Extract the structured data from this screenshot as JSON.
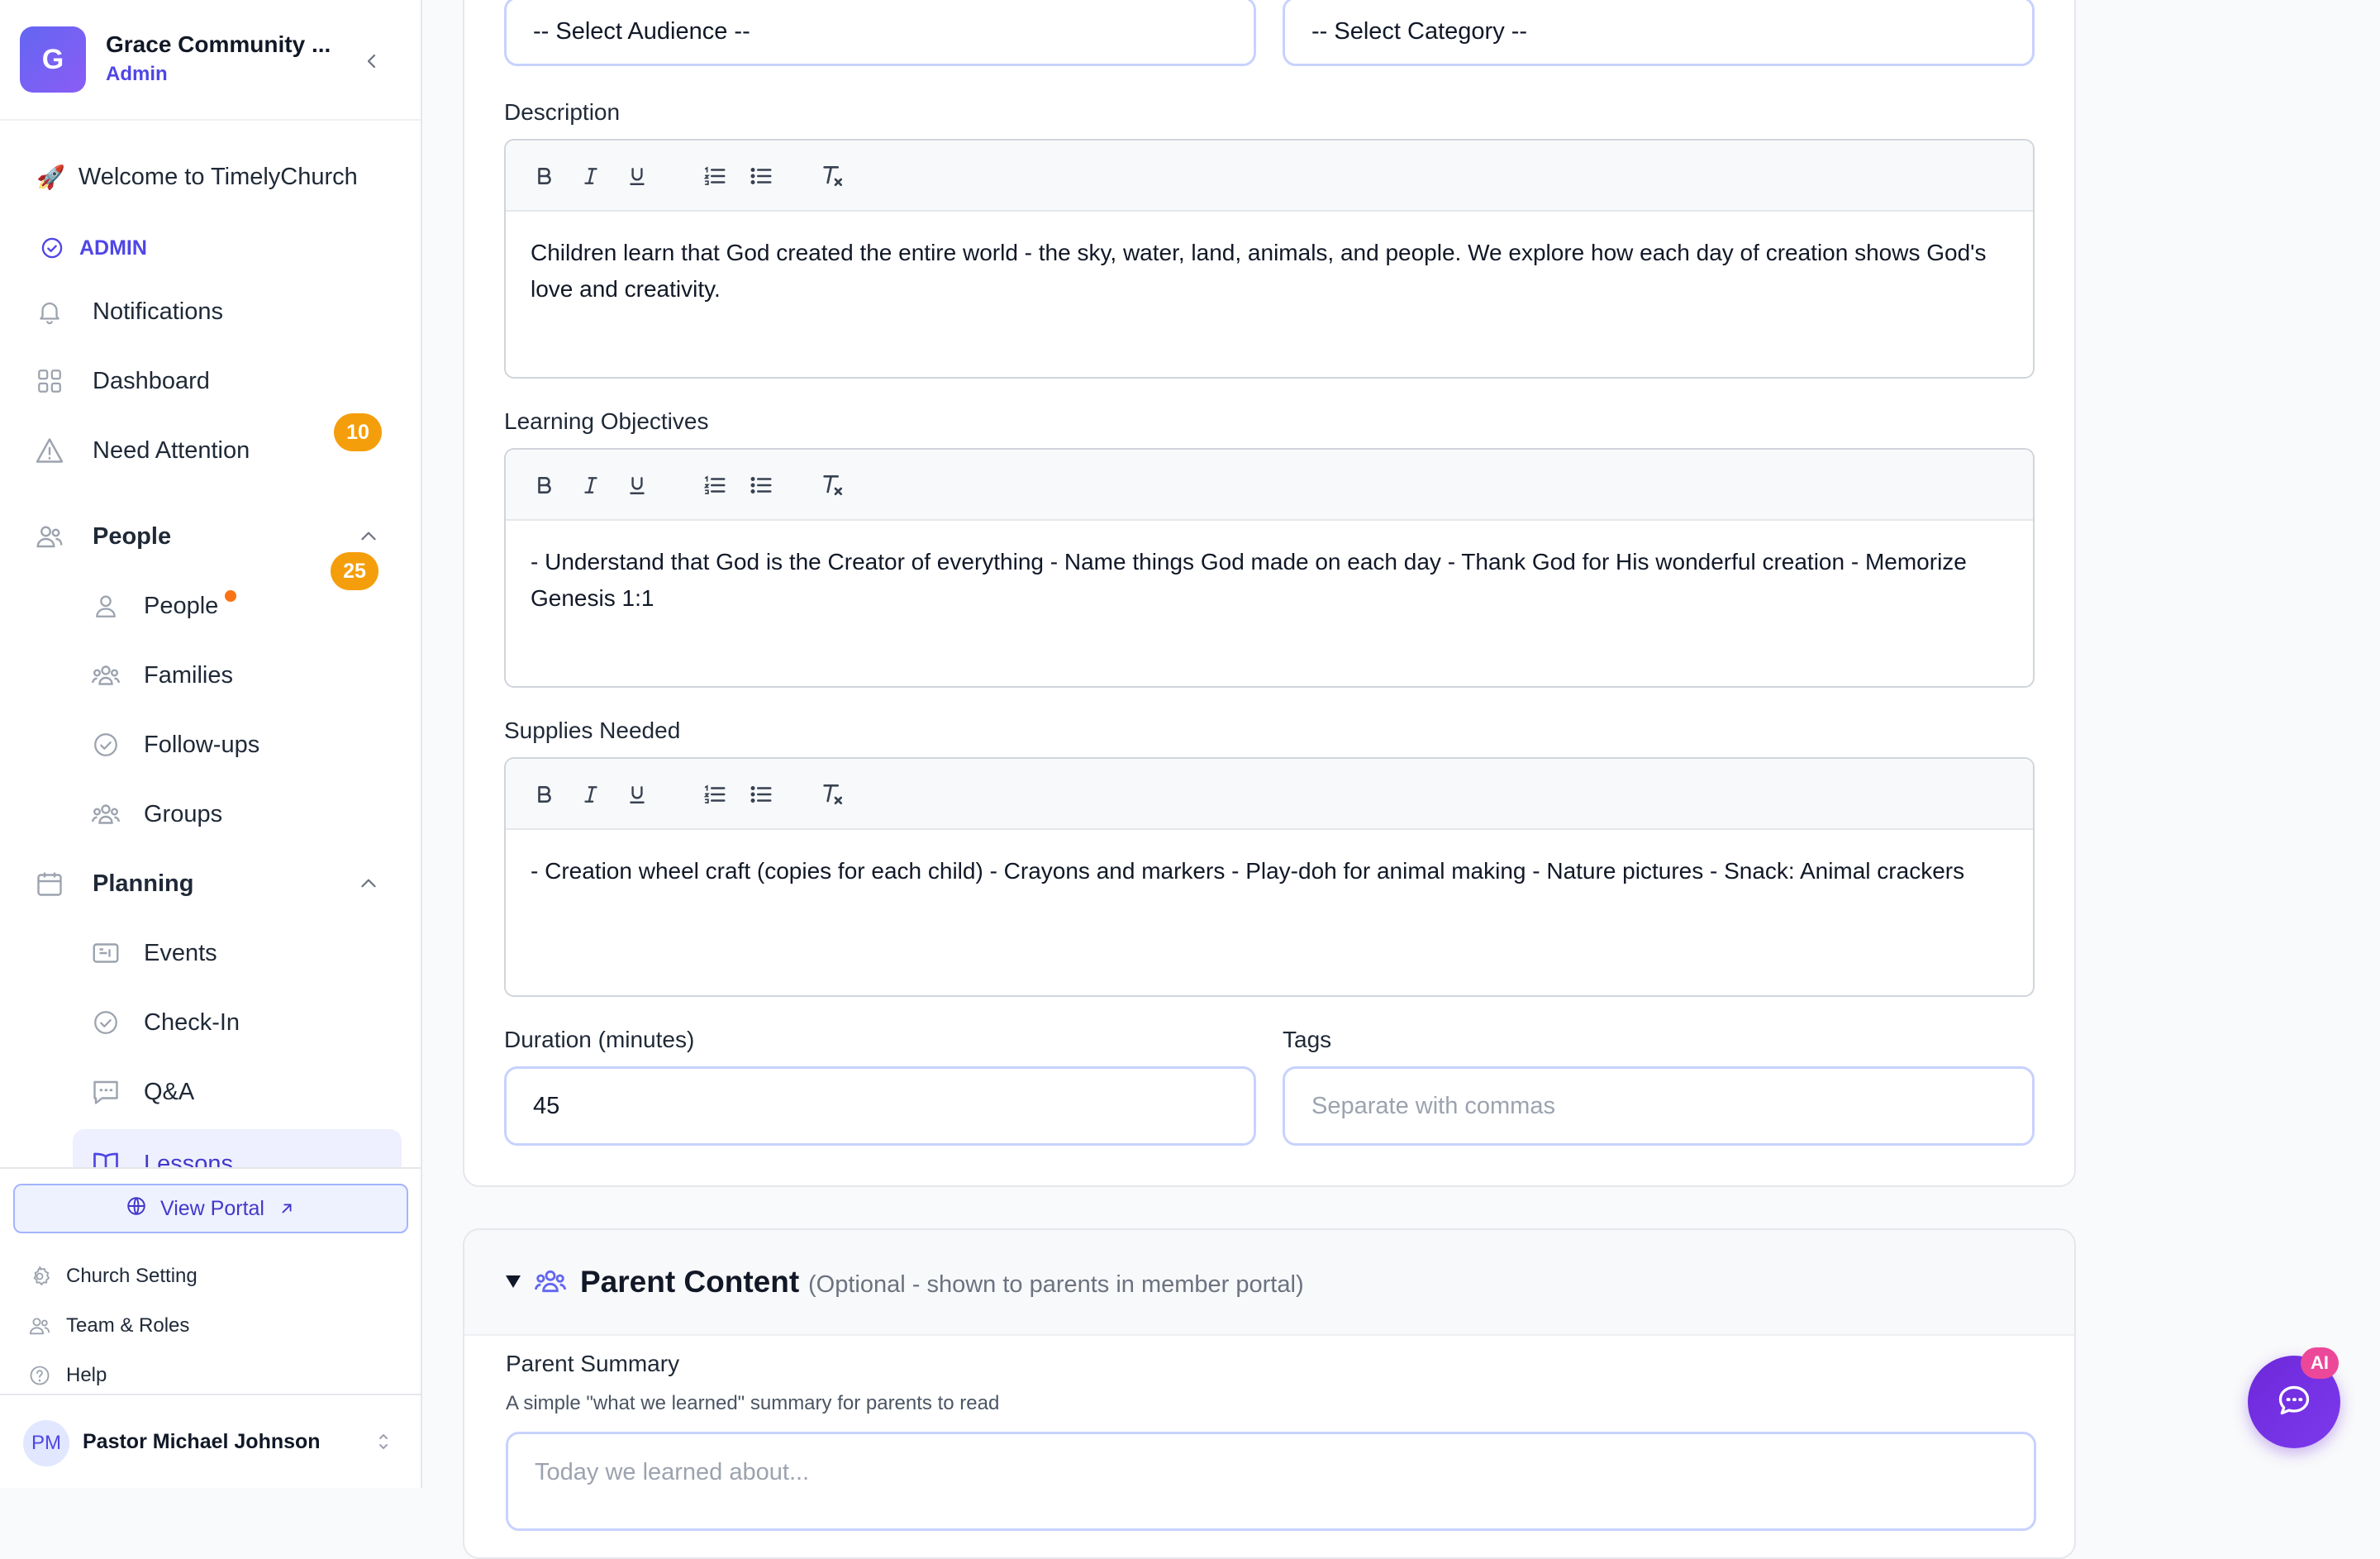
{
  "org": {
    "initial": "G",
    "name": "Grace Community ...",
    "role": "Admin"
  },
  "nav": {
    "welcome": "Welcome to TimelyChurch",
    "admin_label": "ADMIN",
    "notifications": {
      "label": "Notifications",
      "count": "10"
    },
    "dashboard": "Dashboard",
    "need_attention": {
      "label": "Need Attention",
      "count": "25"
    },
    "people_section": "People",
    "people_items": [
      "People",
      "Families",
      "Follow-ups",
      "Groups"
    ],
    "planning_section": "Planning",
    "planning_items": [
      "Events",
      "Check-In",
      "Q&A",
      "Lessons"
    ]
  },
  "footer": {
    "view_portal": "View Portal",
    "links": [
      "Church Setting",
      "Team & Roles",
      "Help"
    ],
    "user": {
      "initials": "PM",
      "name": "Pastor Michael Johnson"
    }
  },
  "form": {
    "audience_select": "-- Select Audience --",
    "category_select": "-- Select Category --",
    "description": {
      "label": "Description",
      "text": "Children learn that God created the entire world - the sky, water, land, animals, and people. We explore how each day of creation shows God's love and creativity."
    },
    "objectives": {
      "label": "Learning Objectives",
      "text": "- Understand that God is the Creator of everything - Name things God made on each day - Thank God for His wonderful creation - Memorize Genesis 1:1"
    },
    "supplies": {
      "label": "Supplies Needed",
      "text": "- Creation wheel craft (copies for each child) - Crayons and markers - Play-doh for animal making - Nature pictures - Snack: Animal crackers"
    },
    "duration": {
      "label": "Duration (minutes)",
      "value": "45"
    },
    "tags": {
      "label": "Tags",
      "placeholder": "Separate with commas"
    }
  },
  "parent": {
    "title": "Parent Content",
    "subtitle": "(Optional - shown to parents in member portal)",
    "summary_label": "Parent Summary",
    "summary_hint": "A simple \"what we learned\" summary for parents to read",
    "summary_placeholder": "Today we learned about..."
  },
  "ai": {
    "badge": "AI"
  },
  "colors": {
    "accent": "#4f46e5",
    "badge": "#f59e0b",
    "ai": "#7c3aed",
    "ai_badge": "#ec4899"
  }
}
